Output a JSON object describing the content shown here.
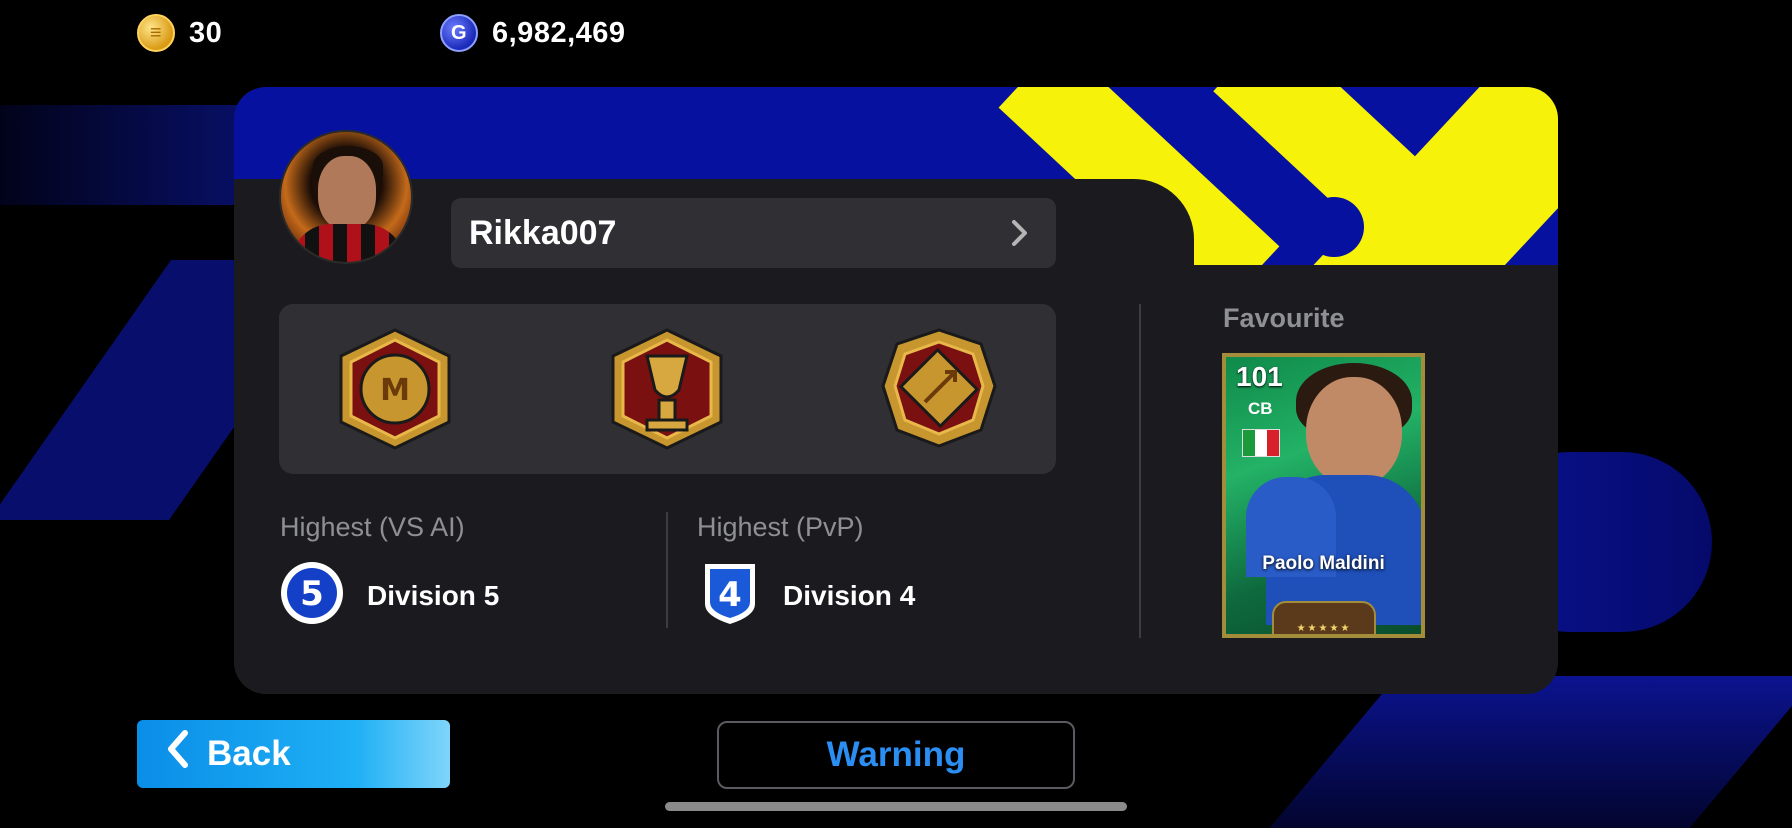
{
  "currency": {
    "coins": "30",
    "gp": "6,982,469"
  },
  "profile": {
    "username": "Rikka007"
  },
  "achievements": [
    "club-medal-icon",
    "trophy-medal-icon",
    "pitch-medal-icon"
  ],
  "stats": {
    "vs_ai": {
      "label": "Highest (VS AI)",
      "division": "Division 5",
      "badge": "5"
    },
    "pvp": {
      "label": "Highest (PvP)",
      "division": "Division 4",
      "badge": "4"
    }
  },
  "favourite": {
    "label": "Favourite",
    "rating": "101",
    "position": "CB",
    "player_name": "Paolo Maldini",
    "stars": "★★★★★"
  },
  "buttons": {
    "back": "Back",
    "warning": "Warning"
  },
  "colors": {
    "banner_blue": "#0711a0",
    "banner_yellow": "#f7f20a",
    "back_button": "#1fb0f5",
    "warning_text": "#2a8ef2"
  }
}
